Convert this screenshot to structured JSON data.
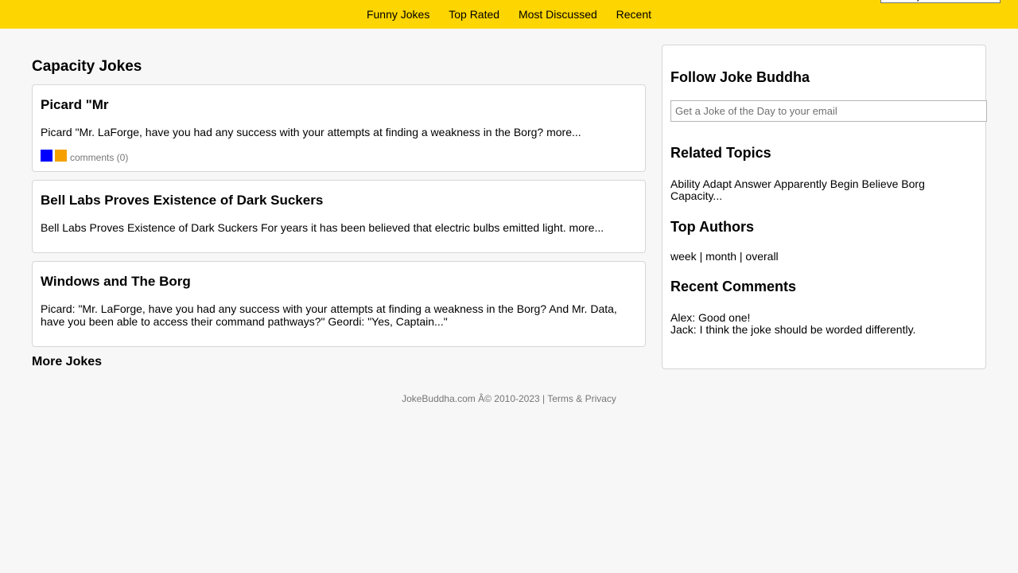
{
  "nav": {
    "items": [
      "Funny Jokes",
      "Top Rated",
      "Most Discussed",
      "Recent"
    ],
    "search_value": "Search jokes"
  },
  "main": {
    "title": "Capacity Jokes",
    "jokes": [
      {
        "title": "Picard \"Mr",
        "body": "Picard \"Mr. LaForge, have you had any success with your attempts at finding a weakness in the Borg? more...",
        "comments": "comments (0)"
      },
      {
        "title": "Bell Labs Proves Existence of Dark Suckers",
        "body": "Bell Labs Proves Existence of Dark Suckers For years it has been believed that electric bulbs emitted light. more..."
      },
      {
        "title": "Windows and The Borg",
        "body": "Picard: \"Mr. LaForge, have you had any success with your attempts at finding a weakness in the Borg? And Mr. Data, have you been able to access their command pathways?\" Geordi: \"Yes, Captain...\""
      }
    ],
    "more_label": "More Jokes"
  },
  "sidebar": {
    "follow_title": "Follow Joke Buddha",
    "email_placeholder": "Get a Joke of the Day to your email",
    "related_title": "Related Topics",
    "related_text": "Ability Adapt Answer Apparently Begin Believe Borg Capacity...",
    "authors_title": "Top Authors",
    "authors_text": "week | month | overall",
    "comments_title": "Recent Comments",
    "comment_1": "Alex: Good one!",
    "comment_2": "Jack: I think the joke should be worded differently."
  },
  "footer": {
    "text": "JokeBuddha.com Â© 2010-2023 | Terms & Privacy"
  },
  "colors": {
    "topbar": "#fdd500",
    "share_blue": "#0000ff",
    "share_orange": "#f5a000"
  },
  "icons": [
    "share-blue-icon",
    "share-orange-icon"
  ]
}
